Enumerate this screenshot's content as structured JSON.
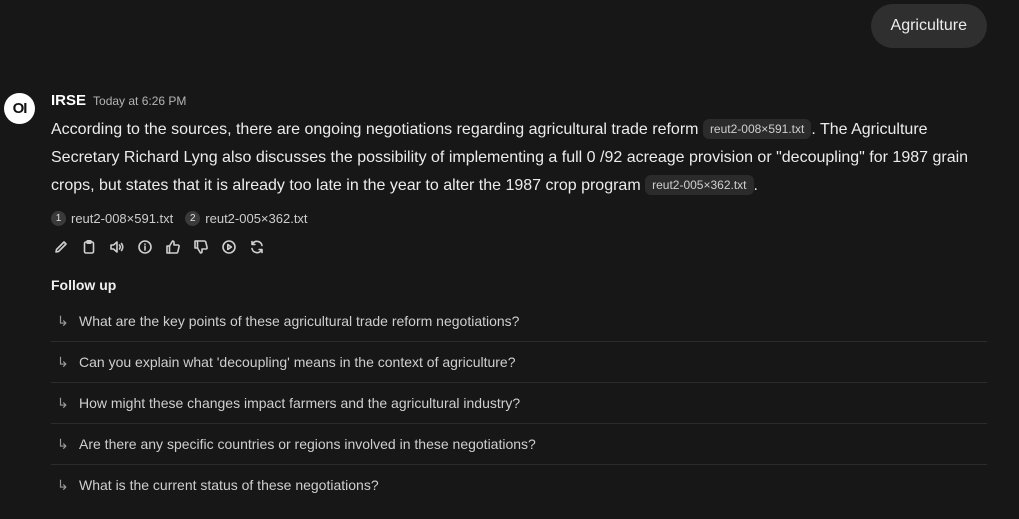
{
  "user_message": "Agriculture",
  "assistant": {
    "avatar_text": "OI",
    "name": "IRSE",
    "timestamp": "Today at 6:26 PM",
    "text_1": "According to the sources, there are ongoing negotiations regarding agricultural trade reform ",
    "citation_1": "reut2-008×591.txt",
    "text_2": ". The Agriculture Secretary Richard Lyng also discusses the possibility of implementing a full 0 /92 acreage provision or \"decoupling\" for 1987 grain crops, but states that it is already too late in the year to alter the 1987 crop program ",
    "citation_2": "reut2-005×362.txt",
    "text_3": ".",
    "sources": [
      {
        "num": "1",
        "name": "reut2-008×591.txt"
      },
      {
        "num": "2",
        "name": "reut2-005×362.txt"
      }
    ],
    "actions": [
      {
        "name": "edit-icon"
      },
      {
        "name": "copy-icon"
      },
      {
        "name": "read-aloud-icon"
      },
      {
        "name": "info-icon"
      },
      {
        "name": "thumbs-up-icon"
      },
      {
        "name": "thumbs-down-icon"
      },
      {
        "name": "continue-icon"
      },
      {
        "name": "regenerate-icon"
      }
    ]
  },
  "followup": {
    "title": "Follow up",
    "arrow": "↳",
    "items": [
      "What are the key points of these agricultural trade reform negotiations?",
      "Can you explain what 'decoupling' means in the context of agriculture?",
      "How might these changes impact farmers and the agricultural industry?",
      "Are there any specific countries or regions involved in these negotiations?",
      "What is the current status of these negotiations?"
    ]
  }
}
